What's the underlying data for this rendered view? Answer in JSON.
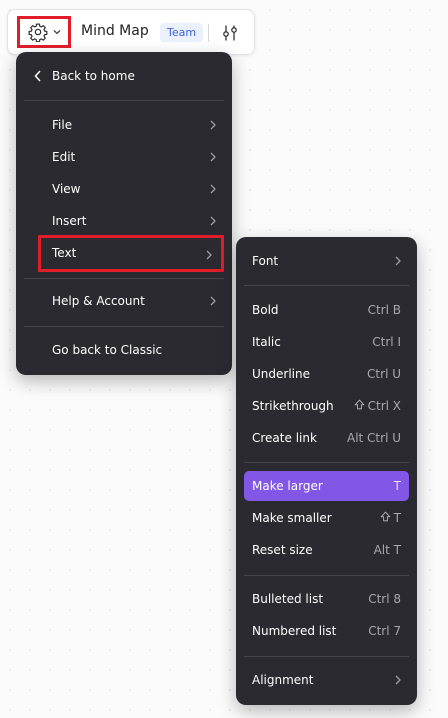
{
  "topbar": {
    "settings_icon": "gear-icon",
    "dropdown_icon": "chevron-down-icon",
    "title": "Mind Map",
    "badge": "Team",
    "filter_icon": "sliders-icon"
  },
  "main_menu": {
    "back_label": "Back to home",
    "items": [
      {
        "label": "File"
      },
      {
        "label": "Edit"
      },
      {
        "label": "View"
      },
      {
        "label": "Insert"
      },
      {
        "label": "Text"
      }
    ],
    "help_label": "Help & Account",
    "classic_label": "Go back to Classic"
  },
  "text_submenu": {
    "font_label": "Font",
    "format_items": [
      {
        "label": "Bold",
        "shortcut": "Ctrl B"
      },
      {
        "label": "Italic",
        "shortcut": "Ctrl I"
      },
      {
        "label": "Underline",
        "shortcut": "Ctrl U"
      },
      {
        "label": "Strikethrough",
        "shortcut": "Ctrl X",
        "shift": true
      },
      {
        "label": "Create link",
        "shortcut": "Alt Ctrl U"
      }
    ],
    "size_items": [
      {
        "label": "Make larger",
        "shortcut": "T"
      },
      {
        "label": "Make smaller",
        "shortcut": "T",
        "shift": true
      },
      {
        "label": "Reset size",
        "shortcut": "Alt T"
      }
    ],
    "list_items": [
      {
        "label": "Bulleted list",
        "shortcut": "Ctrl 8"
      },
      {
        "label": "Numbered list",
        "shortcut": "Ctrl 7"
      }
    ],
    "alignment_label": "Alignment"
  },
  "colors": {
    "menu_bg": "#2a2a30",
    "active_item": "#8257e6",
    "highlight_outline": "#e11d2a",
    "badge_text": "#3d63dd"
  }
}
